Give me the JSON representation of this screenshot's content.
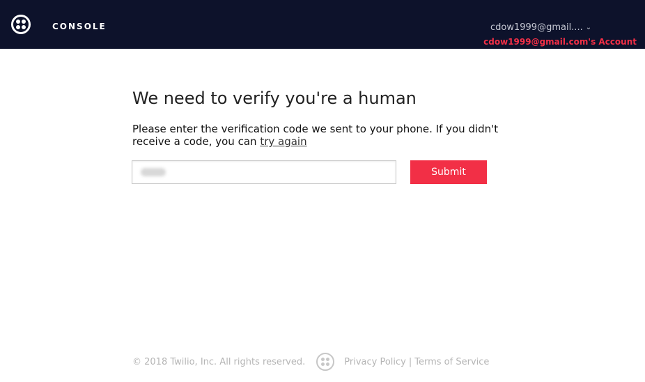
{
  "header": {
    "logo_icon": "twilio-logo-icon",
    "title": "CONSOLE",
    "account_email": "cdow1999@gmail....",
    "account_name": "cdow1999@gmail.com's Account",
    "chevron_icon": "chevron-down-icon"
  },
  "main": {
    "heading": "We need to verify you're a human",
    "instruction_text": "Please enter the verification code we sent to your phone. If you didn't receive a code, you can",
    "try_again_link": "try again",
    "code_input_value": "",
    "submit_label": "Submit"
  },
  "footer": {
    "copyright": "© 2018 Twilio, Inc. All rights reserved.",
    "privacy_link": "Privacy Policy",
    "separator": "|",
    "terms_link": "Terms of Service"
  },
  "colors": {
    "header_bg": "#0d122b",
    "accent": "#f22f46"
  }
}
